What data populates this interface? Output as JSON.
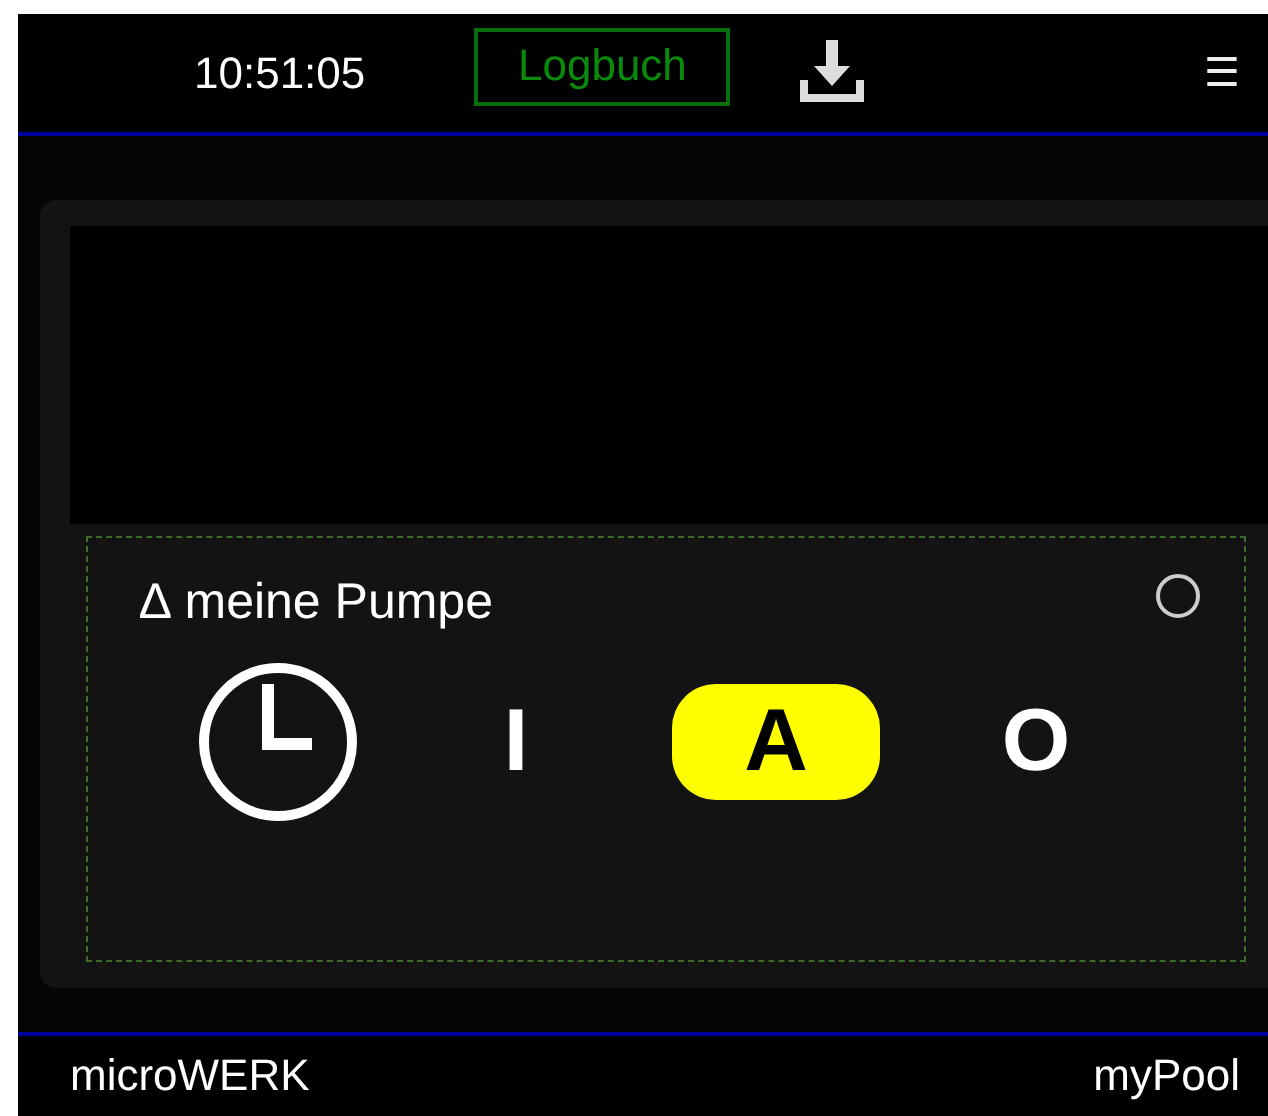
{
  "header": {
    "time": "10:51:05",
    "log_button": "Logbuch",
    "menu": "☰"
  },
  "device": {
    "title": "∆ meine Pumpe",
    "modes": [
      {
        "kind": "clock",
        "selected": false
      },
      {
        "kind": "text",
        "label": "I",
        "selected": false
      },
      {
        "kind": "text",
        "label": "A",
        "selected": true
      },
      {
        "kind": "text",
        "label": "O",
        "selected": false
      }
    ]
  },
  "footer": {
    "brand": "microWERK",
    "product": "myPool"
  }
}
